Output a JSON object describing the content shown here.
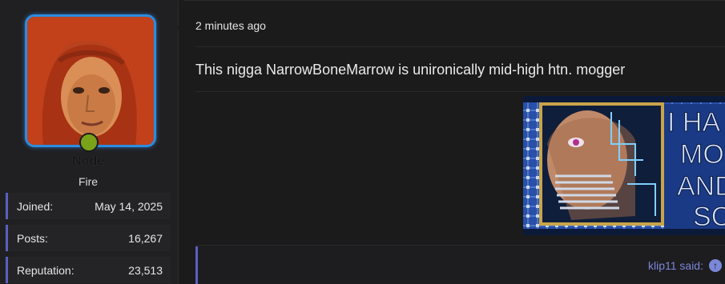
{
  "user": {
    "name": "Node",
    "title": "Fire",
    "stats": [
      {
        "label": "Joined:",
        "value": "May 14, 2025"
      },
      {
        "label": "Posts:",
        "value": "16,267"
      },
      {
        "label": "Reputation:",
        "value": "23,513"
      }
    ],
    "online": true,
    "avatar_icon": "avatar-portrait-red-hood"
  },
  "post": {
    "time": "2 minutes ago",
    "text": "This nigga NarrowBoneMarrow is unironically mid-high htn. mogger",
    "image": {
      "icon": "meme-circuit-face-image",
      "text_lines": [
        "I HA",
        "MO",
        "AND",
        "SC"
      ]
    }
  },
  "quote": {
    "author": "klip11 said:",
    "icon": "arrow-up-circle-icon"
  },
  "colors": {
    "accent": "#5a5fc0",
    "avatar_border": "#2b8de0",
    "online": "#7aa319",
    "quote_link": "#7b87d8"
  }
}
